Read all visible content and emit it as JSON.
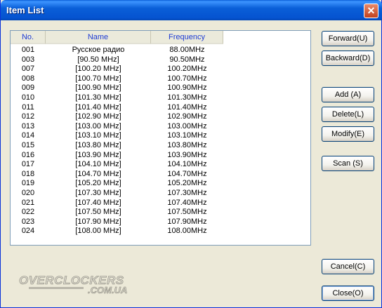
{
  "window": {
    "title": "Item List",
    "close_glyph": "✕"
  },
  "list": {
    "headers": {
      "no": "No.",
      "name": "Name",
      "frequency": "Frequency"
    },
    "rows": [
      {
        "no": "001",
        "name": "Русское радио",
        "freq": "88.00MHz"
      },
      {
        "no": "003",
        "name": "[90.50 MHz]",
        "freq": "90.50MHz"
      },
      {
        "no": "007",
        "name": "[100.20 MHz]",
        "freq": "100.20MHz"
      },
      {
        "no": "008",
        "name": "[100.70 MHz]",
        "freq": "100.70MHz"
      },
      {
        "no": "009",
        "name": "[100.90 MHz]",
        "freq": "100.90MHz"
      },
      {
        "no": "010",
        "name": "[101.30 MHz]",
        "freq": "101.30MHz"
      },
      {
        "no": "011",
        "name": "[101.40 MHz]",
        "freq": "101.40MHz"
      },
      {
        "no": "012",
        "name": "[102.90 MHz]",
        "freq": "102.90MHz"
      },
      {
        "no": "013",
        "name": "[103.00 MHz]",
        "freq": "103.00MHz"
      },
      {
        "no": "014",
        "name": "[103.10 MHz]",
        "freq": "103.10MHz"
      },
      {
        "no": "015",
        "name": "[103.80 MHz]",
        "freq": "103.80MHz"
      },
      {
        "no": "016",
        "name": "[103.90 MHz]",
        "freq": "103.90MHz"
      },
      {
        "no": "017",
        "name": "[104.10 MHz]",
        "freq": "104.10MHz"
      },
      {
        "no": "018",
        "name": "[104.70 MHz]",
        "freq": "104.70MHz"
      },
      {
        "no": "019",
        "name": "[105.20 MHz]",
        "freq": "105.20MHz"
      },
      {
        "no": "020",
        "name": "[107.30 MHz]",
        "freq": "107.30MHz"
      },
      {
        "no": "021",
        "name": "[107.40 MHz]",
        "freq": "107.40MHz"
      },
      {
        "no": "022",
        "name": "[107.50 MHz]",
        "freq": "107.50MHz"
      },
      {
        "no": "023",
        "name": "[107.90 MHz]",
        "freq": "107.90MHz"
      },
      {
        "no": "024",
        "name": "[108.00 MHz]",
        "freq": "108.00MHz"
      }
    ]
  },
  "buttons": {
    "forward": "Forward(U)",
    "backward": "Backward(D)",
    "add": "Add (A)",
    "delete": "Delete(L)",
    "modify": "Modify(E)",
    "scan": "Scan (S)",
    "cancel": "Cancel(C)",
    "close": "Close(O)"
  },
  "watermark": {
    "text": "OVERCLOCKERS.COM.UA"
  },
  "colors": {
    "titlebar": "#0a5fd8",
    "header_text": "#1d3bd4",
    "button_border": "#003c74"
  }
}
